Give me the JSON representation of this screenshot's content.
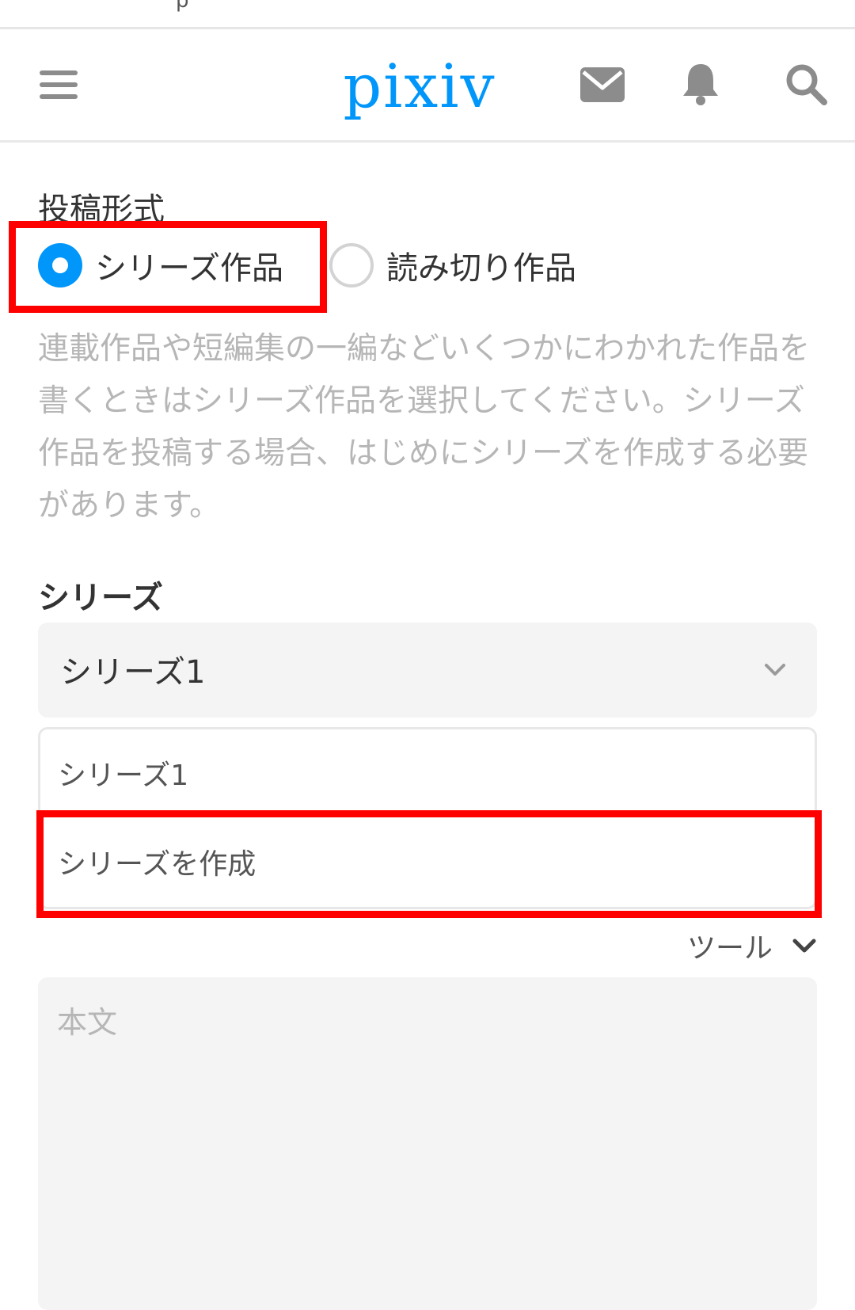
{
  "status_bar": {
    "fragment": "p"
  },
  "header": {
    "logo_text": "pixiv",
    "menu_icon": "hamburger-menu-icon",
    "mail_icon": "mail-icon",
    "bell_icon": "bell-icon",
    "search_icon": "search-icon",
    "brand_color": "#0096fa"
  },
  "post_type": {
    "title": "投稿形式",
    "options": [
      {
        "label": "シリーズ作品",
        "selected": true
      },
      {
        "label": "読み切り作品",
        "selected": false
      }
    ],
    "description": "連載作品や短編集の一編などいくつかにわかれた作品を書くときはシリーズ作品を選択してください。シリーズ作品を投稿する場合、はじめにシリーズを作成する必要があります。"
  },
  "series": {
    "title": "シリーズ",
    "selected_value": "シリーズ1",
    "dropdown_options": [
      "シリーズ1",
      "シリーズを作成"
    ]
  },
  "tools": {
    "label": "ツール"
  },
  "body_field": {
    "placeholder": "本文",
    "value": ""
  },
  "annotation": {
    "highlight_color": "#ff0000"
  }
}
